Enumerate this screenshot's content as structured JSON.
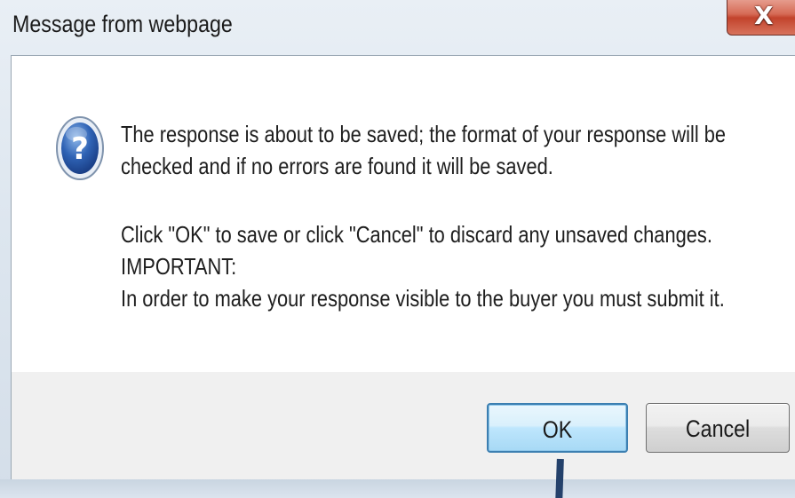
{
  "window": {
    "title": "Message from webpage",
    "close_glyph": "X",
    "close_icon": "close-icon"
  },
  "dialog": {
    "icon": "question-icon",
    "lines": [
      "The response is about to be saved; the format of your response will be",
      "checked and if no errors are found it will be saved.",
      "Click \"OK\" to save or click \"Cancel\" to discard any unsaved changes.",
      "IMPORTANT:",
      "In order to make your response visible to the buyer you must submit it."
    ]
  },
  "buttons": {
    "ok_label": "OK",
    "cancel_label": "Cancel"
  },
  "colors": {
    "close_button": "#c2432c",
    "ok_border": "#3c7fb1",
    "pointer": "#24416b"
  }
}
